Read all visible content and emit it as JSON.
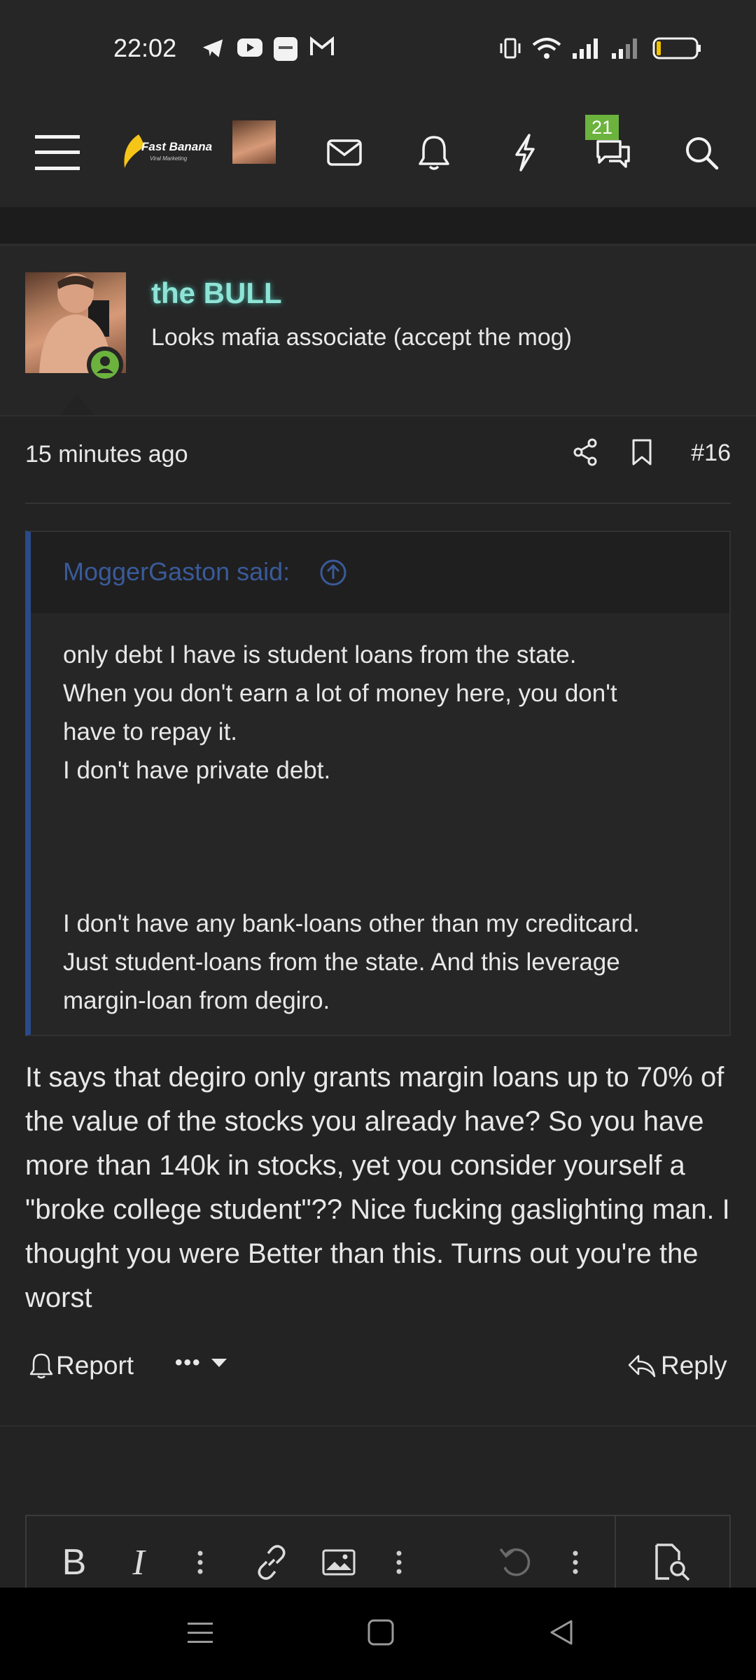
{
  "status_bar": {
    "time": "22:02",
    "icons": [
      "telegram-icon",
      "youtube-icon",
      "app-icon",
      "gmail-icon",
      "vibrate-icon",
      "wifi-icon",
      "signal-icon",
      "signal-icon",
      "battery-icon"
    ]
  },
  "header": {
    "menu_icon": "hamburger-icon",
    "logo_text": "Fast Banana",
    "logo_subtext": "Viral Marketing",
    "icons": [
      "mail-icon",
      "bell-icon",
      "lightning-icon",
      "chat-icon",
      "search-icon"
    ],
    "chat_badge": "21"
  },
  "post": {
    "user_name": "the BULL",
    "user_title": "Looks mafia associate (accept the mog)",
    "time": "15 minutes ago",
    "post_number": "#16",
    "quote": {
      "author": "MoggerGaston said:",
      "paragraph1": [
        "only debt I have is student loans from the state.",
        "When you don't earn a lot of money here, you don't",
        "have to repay it.",
        "I don't have private debt."
      ],
      "paragraph2": [
        "I don't have any bank-loans other than my creditcard.",
        "Just student-loans from the state. And this leverage",
        "margin-loan from degiro."
      ]
    },
    "body": "It says that degiro only grants margin loans up to 70% of the value of the stocks you already have? So you have more than 140k in stocks, yet you consider yourself a \"broke college student\"?? Nice fucking gaslighting man. I thought you were Better than this. Turns out you're the worst",
    "actions": {
      "report": "Report",
      "more": "•••",
      "reply": "Reply"
    }
  },
  "editor": {
    "bold": "B",
    "italic": "I"
  },
  "colors": {
    "background": "#232323",
    "username_glow": "#8ee4d6",
    "quote_border": "#2b4a8a",
    "quote_author": "#3a5a9a",
    "badge": "#6cb33e",
    "online": "#6cb33e"
  }
}
